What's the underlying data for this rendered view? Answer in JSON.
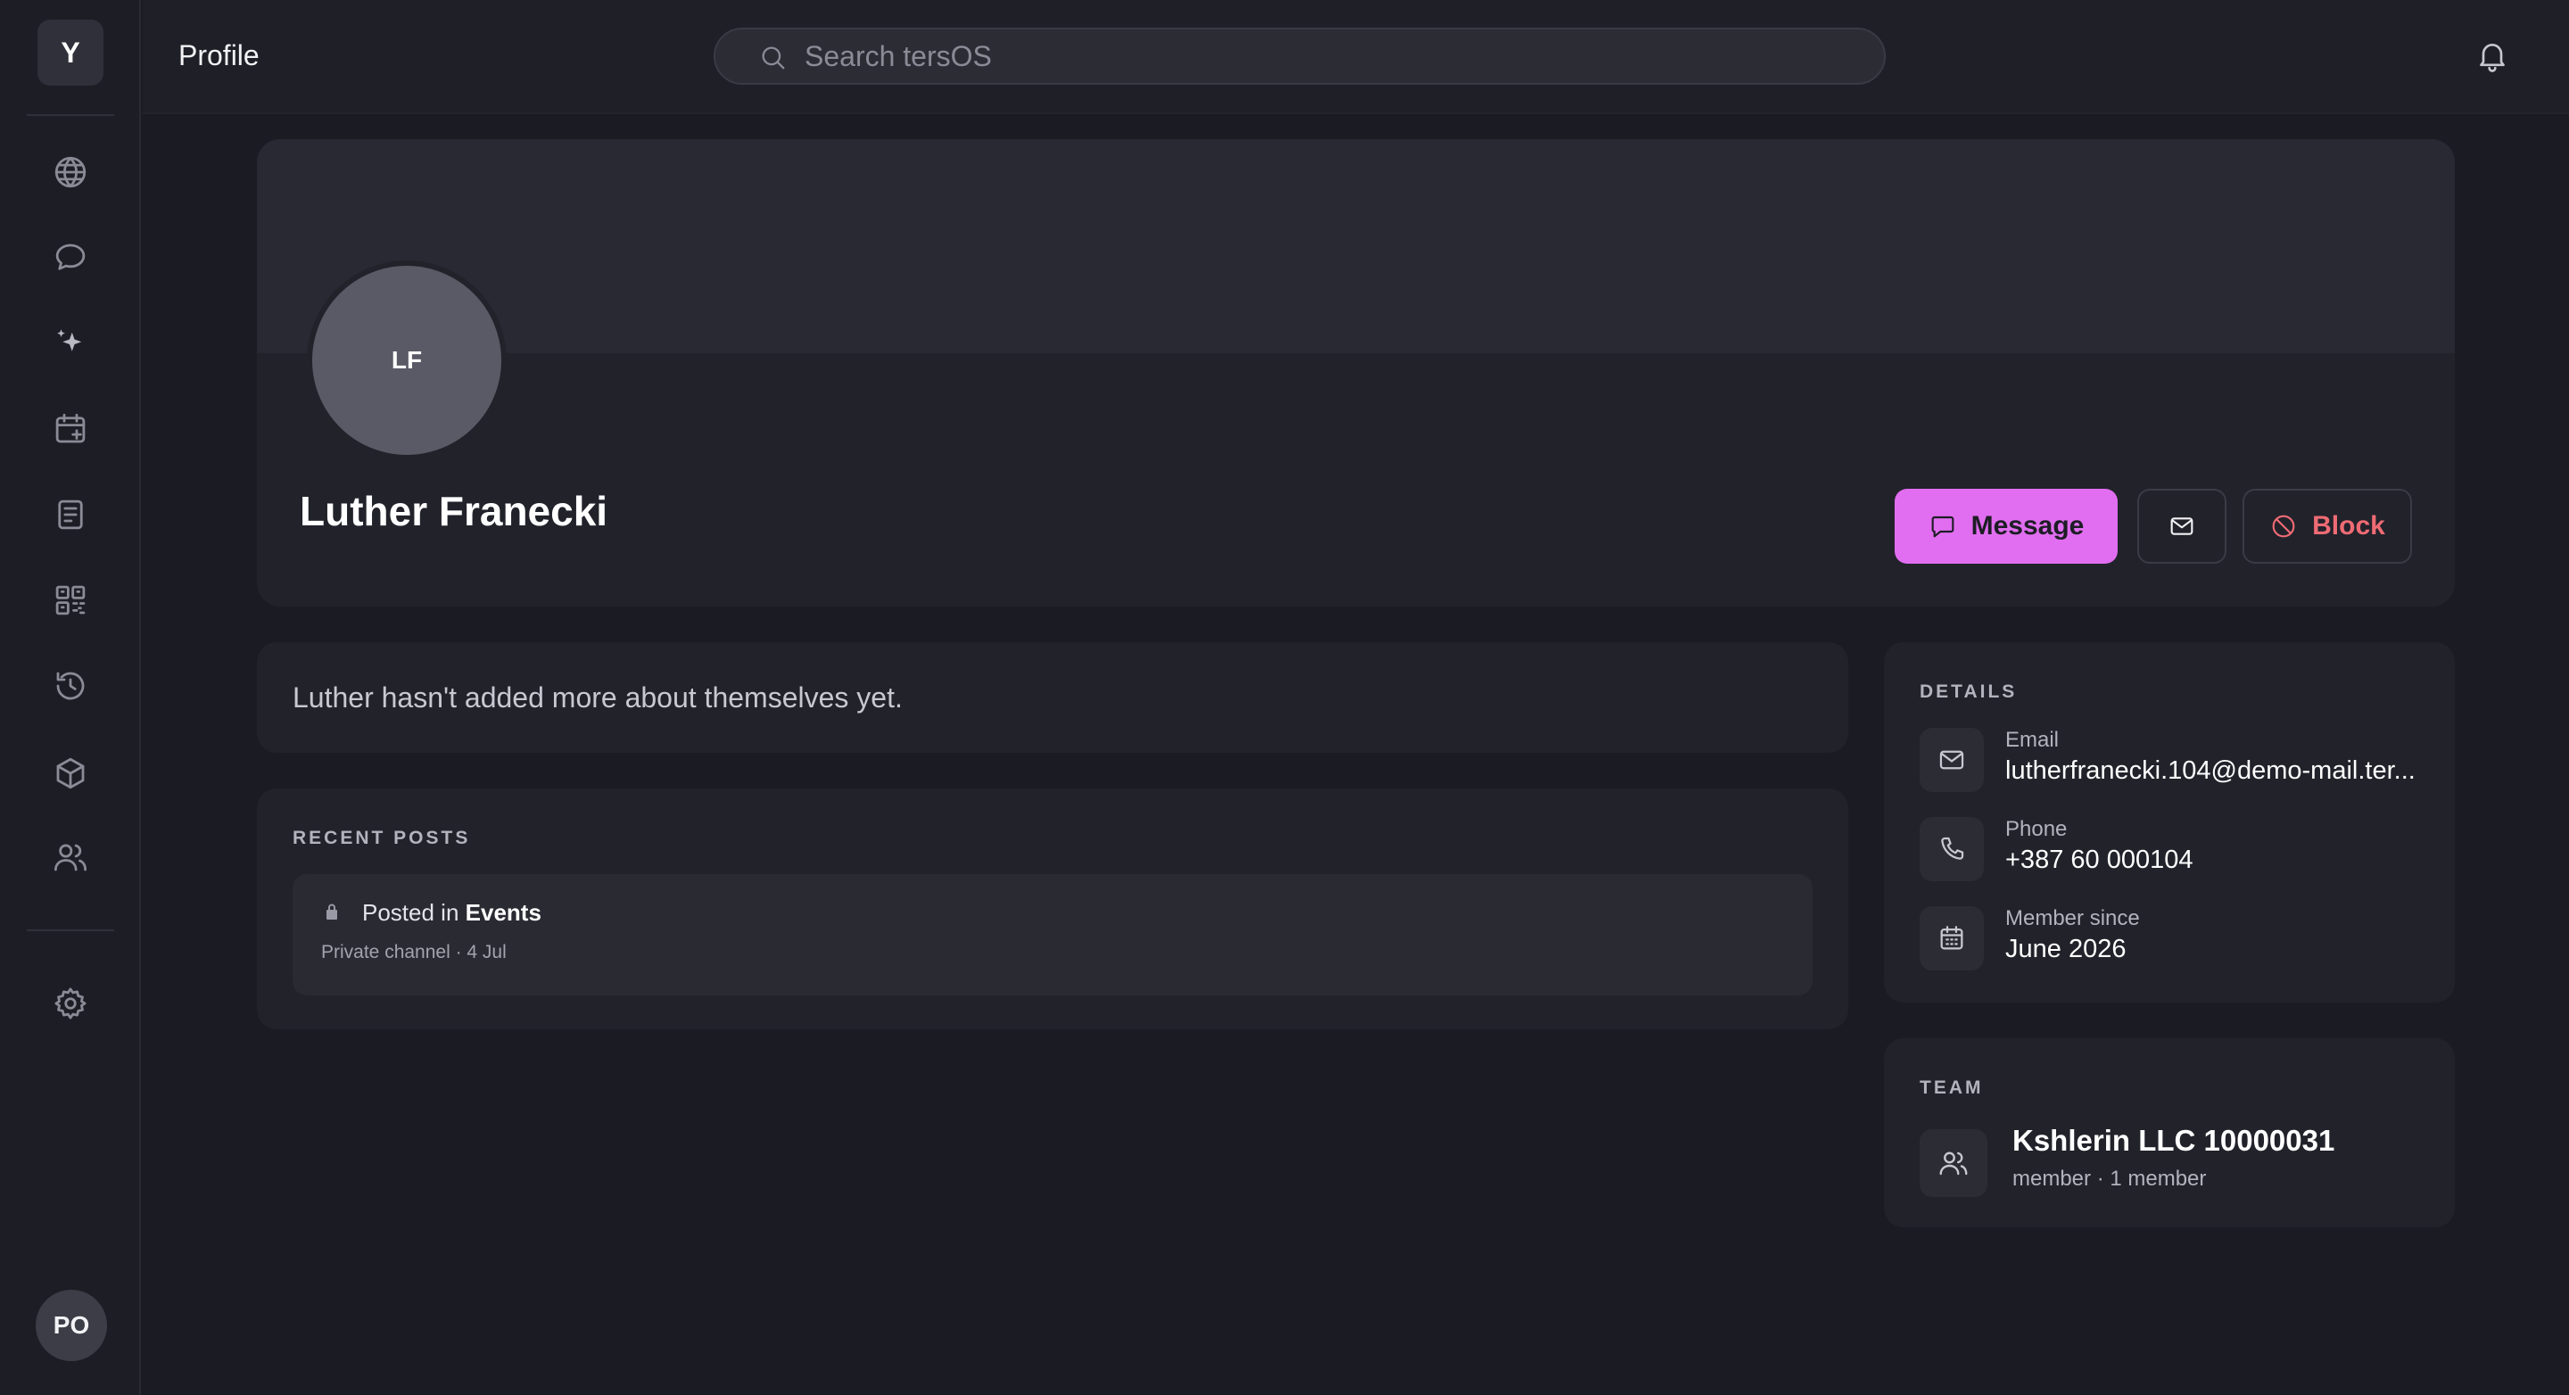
{
  "app": {
    "workspace_initial": "Y",
    "user_initials": "PO"
  },
  "sidebar": {
    "items": [
      {
        "icon": "globe-icon"
      },
      {
        "icon": "chat-bubble-icon"
      },
      {
        "icon": "sparkles-icon"
      },
      {
        "icon": "calendar-plus-icon"
      },
      {
        "icon": "document-icon"
      },
      {
        "icon": "qr-code-icon"
      },
      {
        "icon": "history-icon"
      },
      {
        "icon": "cube-icon"
      },
      {
        "icon": "users-icon"
      },
      {
        "icon": "settings-gear-icon"
      }
    ]
  },
  "header": {
    "page_title": "Profile",
    "search_placeholder": "Search tersOS"
  },
  "profile": {
    "initials": "LF",
    "name": "Luther Franecki",
    "actions": {
      "message_label": "Message",
      "block_label": "Block"
    },
    "about": "Luther hasn't added more about themselves yet."
  },
  "recent_posts": {
    "label": "RECENT POSTS",
    "items": [
      {
        "prefix": "Posted in ",
        "channel": "Events",
        "meta": "Private channel · 4 Jul"
      }
    ]
  },
  "details": {
    "label": "DETAILS",
    "email_label": "Email",
    "email_value": "lutherfranecki.104@demo-mail.ter...",
    "phone_label": "Phone",
    "phone_value": "+387 60 000104",
    "member_since_label": "Member since",
    "member_since_value": "June 2026"
  },
  "team": {
    "label": "TEAM",
    "name": "Kshlerin LLC 10000031",
    "meta": "member · 1 member"
  },
  "colors": {
    "accent": "#e16ef0",
    "danger": "#ef6b74",
    "background": "#1b1b23",
    "card": "#22222b"
  }
}
